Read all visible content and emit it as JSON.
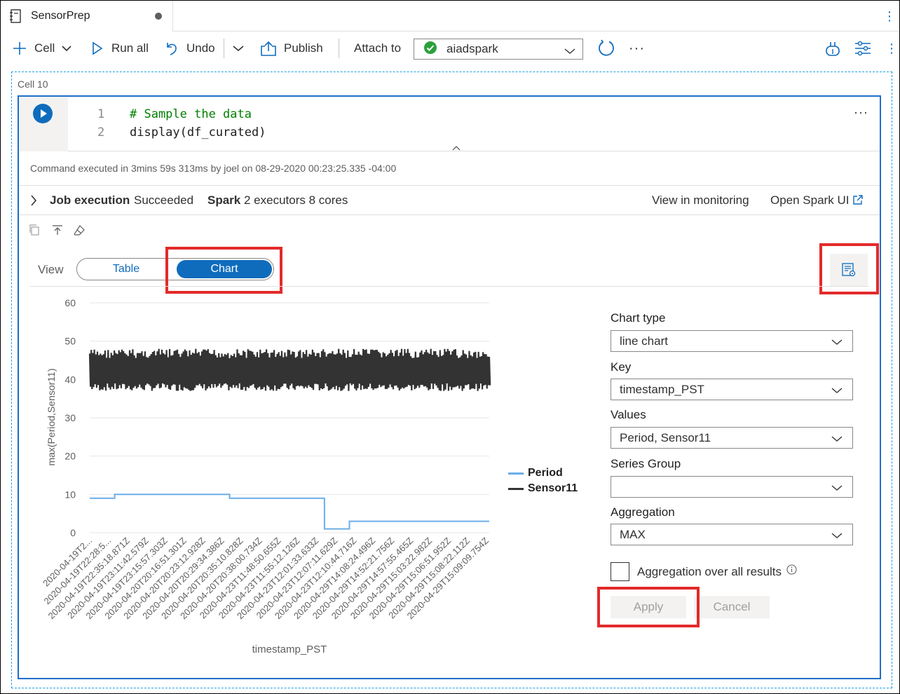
{
  "notebook": {
    "tab_title": "SensorPrep",
    "more": "⋮"
  },
  "toolbar": {
    "cell_label": "Cell",
    "run_all_label": "Run all",
    "undo_label": "Undo",
    "publish_label": "Publish",
    "attach_to_label": "Attach to",
    "attach_value": "aiadspark",
    "more": "···"
  },
  "cell": {
    "label": "Cell 10",
    "line_numbers": [
      "1",
      "2"
    ],
    "code_lines": [
      "# Sample the data",
      "display(df_curated)"
    ],
    "more": "···",
    "exec_meta": "Command executed in 3mins 59s 313ms by joel on 08-29-2020 00:23:25.335 -04:00"
  },
  "job": {
    "job_execution_label": "Job execution",
    "job_status": "Succeeded",
    "spark_label": "Spark",
    "spark_info": "2 executors 8 cores",
    "view_monitoring": "View in monitoring",
    "open_spark_ui": "Open Spark UI"
  },
  "view": {
    "label": "View",
    "table": "Table",
    "chart": "Chart"
  },
  "settings": {
    "chart_type_label": "Chart type",
    "chart_type_value": "line chart",
    "key_label": "Key",
    "key_value": "timestamp_PST",
    "values_label": "Values",
    "values_value": "Period, Sensor11",
    "series_group_label": "Series Group",
    "series_group_value": "",
    "aggregation_label": "Aggregation",
    "aggregation_value": "MAX",
    "aggregation_all_label": "Aggregation over all results",
    "aggregation_all_checked": false,
    "apply": "Apply",
    "cancel": "Cancel"
  },
  "colors": {
    "accent": "#0f6cbd",
    "highlight": "#e32a2a",
    "period": "#6aaee9",
    "sensor11": "#333333"
  },
  "chart_data": {
    "type": "line",
    "xlabel": "timestamp_PST",
    "ylabel": "max(Period,Sensor11)",
    "ylim": [
      0,
      60
    ],
    "yticks": [
      "0",
      "10",
      "20",
      "30",
      "40",
      "50",
      "60"
    ],
    "grid": true,
    "legend_position": "right",
    "x_tick_labels": [
      "2020-04-19T2...",
      "2020-04-19T22:28:5...",
      "2020-04-19T22:35:18.871Z",
      "2020-04-19T23:11:42.579Z",
      "2020-04-19T23:15:57.303Z",
      "2020-04-20T20:16:51.301Z",
      "2020-04-20T20:23:12.928Z",
      "2020-04-20T20:29:34.386Z",
      "2020-04-20T20:35:10.828Z",
      "2020-04-20T20:38:00.734Z",
      "2020-04-23T11:48:50.655Z",
      "2020-04-23T11:55:12.126Z",
      "2020-04-23T12:01:33.633Z",
      "2020-04-23T12:07:11.629Z",
      "2020-04-23T12:10:44.716Z",
      "2020-04-29T14:08:24.496Z",
      "2020-04-29T14:52:21.756Z",
      "2020-04-29T14:57:55.465Z",
      "2020-04-29T15:03:22.982Z",
      "2020-04-29T15:06:51.952Z",
      "2020-04-29T15:08:22.112Z",
      "2020-04-29T15:09:09.754Z"
    ],
    "series": [
      {
        "name": "Period",
        "values": [
          9,
          9,
          9,
          9,
          9,
          10,
          10,
          10,
          10,
          10,
          10,
          10,
          10,
          10,
          10,
          10,
          10,
          10,
          10,
          10,
          10,
          10,
          10,
          10,
          10,
          10,
          10,
          10,
          9,
          9,
          9,
          9,
          9,
          9,
          9,
          9,
          9,
          9,
          9,
          9,
          9,
          9,
          9,
          9,
          9,
          9,
          9,
          1,
          1,
          1,
          1,
          1,
          3,
          3,
          3,
          3,
          3,
          3,
          3,
          3,
          3,
          3,
          3,
          3,
          3,
          3,
          3,
          3,
          3,
          3,
          3,
          3,
          3,
          3,
          3,
          3,
          3,
          3,
          3,
          3
        ]
      },
      {
        "name": "Sensor11",
        "min": 37,
        "max": 48,
        "description_range": "oscillates between ~37 and ~48"
      }
    ]
  }
}
